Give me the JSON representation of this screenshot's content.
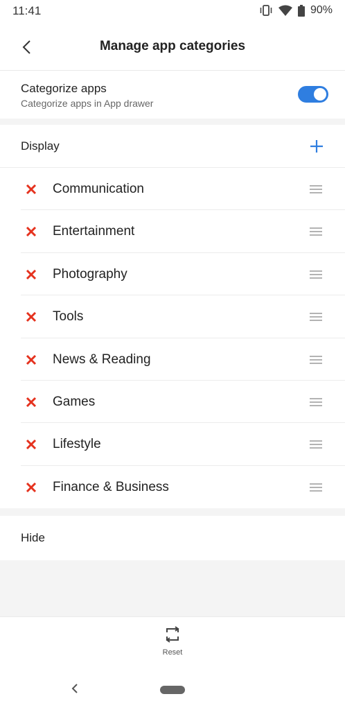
{
  "status_bar": {
    "time": "11:41",
    "battery": "90%",
    "icons": [
      "vibrate-icon",
      "wifi-icon",
      "battery-icon"
    ]
  },
  "app_bar": {
    "title": "Manage app categories",
    "back_icon": "chevron-left-icon"
  },
  "categorize": {
    "title": "Categorize apps",
    "subtitle": "Categorize apps in App drawer",
    "enabled": true
  },
  "display": {
    "label": "Display",
    "add_icon": "plus-icon",
    "categories": [
      {
        "label": "Communication"
      },
      {
        "label": "Entertainment"
      },
      {
        "label": "Photography"
      },
      {
        "label": "Tools"
      },
      {
        "label": "News & Reading"
      },
      {
        "label": "Games"
      },
      {
        "label": "Lifestyle"
      },
      {
        "label": "Finance & Business"
      }
    ]
  },
  "hide": {
    "label": "Hide"
  },
  "bottom": {
    "reset_label": "Reset",
    "reset_icon": "reset-icon"
  },
  "colors": {
    "accent": "#2f7ee0",
    "remove": "#e5321e",
    "handle": "#9a9a9a",
    "background": "#f4f4f4"
  }
}
